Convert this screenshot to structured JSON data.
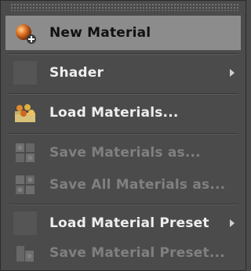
{
  "menu": {
    "items": [
      {
        "label": "New Material",
        "icon": "new-material-icon"
      },
      {
        "label": "Shader",
        "icon": "blank-icon",
        "submenu": true
      },
      {
        "label": "Load Materials...",
        "icon": "load-materials-icon"
      },
      {
        "label": "Save Materials as...",
        "icon": "save-materials-icon",
        "disabled": true
      },
      {
        "label": "Save All Materials as...",
        "icon": "save-all-materials-icon",
        "disabled": true
      },
      {
        "label": "Load Material Preset",
        "icon": "blank-icon",
        "submenu": true
      },
      {
        "label": "Save Material Preset...",
        "icon": "save-preset-icon",
        "disabled": true
      }
    ]
  },
  "colors": {
    "menu_bg": "#4b4b4b",
    "highlight_bg": "#8c8c8c",
    "text": "#eeeeee",
    "disabled_text": "#808080"
  }
}
